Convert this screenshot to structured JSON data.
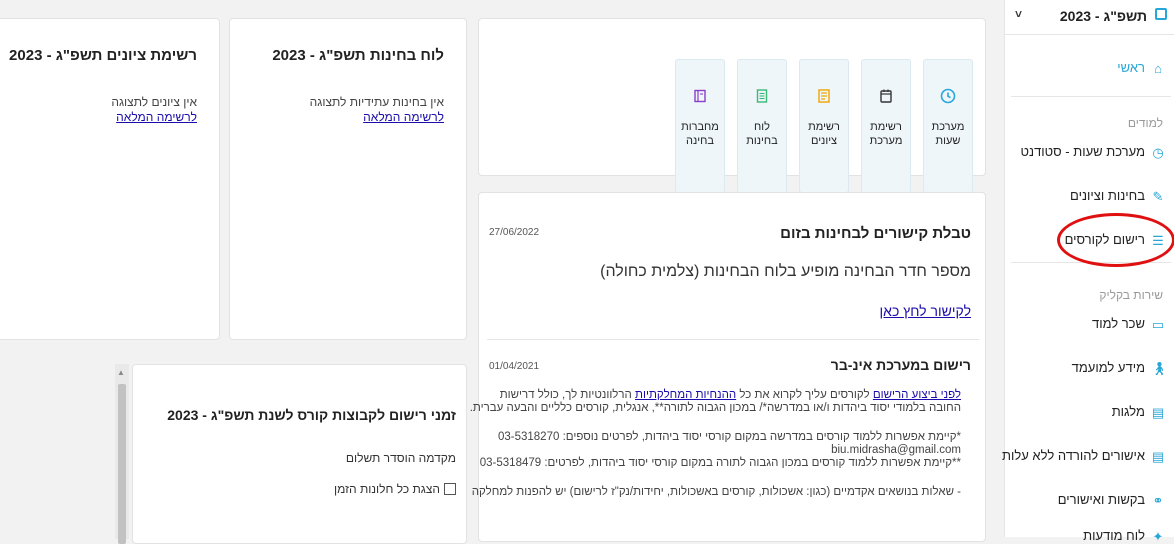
{
  "sidebar": {
    "year": "תשפ\"ג - 2023",
    "home": "ראשי",
    "section_students": "למודים",
    "timetable": "מערכת שעות - סטודנט",
    "exams_grades": "בחינות וציונים",
    "course_registration": "רישום לקורסים",
    "section_services": "שירות בקליק",
    "tuition": "שכר למוד",
    "applicant_info": "מידע למועמד",
    "scholarships": "מלגות",
    "download_confirmations": "אישורים להורדה ללא עלות",
    "requests": "בקשות ואישורים",
    "more": "לוח מודעות"
  },
  "quick_links": [
    {
      "label": "מערכת\nשעות",
      "icon": "clock-icon"
    },
    {
      "label": "רשימת\nמערכת",
      "icon": "calendar-icon"
    },
    {
      "label": "רשימת\nציונים",
      "icon": "list-icon"
    },
    {
      "label": "לוח בחינות",
      "icon": "document-icon"
    },
    {
      "label": "מחברות\nבחינה",
      "icon": "notebook-icon"
    }
  ],
  "colors": {
    "accent": "#27a6d8",
    "tile_bg": "#eef6fa",
    "highlight": "#e11010"
  },
  "exam_schedule": {
    "title": "לוח בחינות תשפ\"ג - 2023",
    "empty": "אין בחינות עתידיות לתצוגה",
    "full_list": "לרשימה המלאה"
  },
  "grades_list": {
    "title": "רשימת ציונים תשפ\"ג - 2023",
    "empty": "אין ציונים לתצוגה",
    "full_list": "לרשימה המלאה"
  },
  "registration_times": {
    "title": "זמני רישום לקבוצות קורס לשנת תשפ\"ג - 2023",
    "prerequisite": "מקדמה הוסדר תשלום",
    "show_all": "הצגת כל חלונות הזמן"
  },
  "posts": [
    {
      "title": "טבלת קישורים לבחינות בזום",
      "date": "27/06/2022",
      "body": "מספר חדר הבחינה מופיע בלוח הבחינות (צלמית כחולה)",
      "link": "לקישור לחץ כאן"
    },
    {
      "title": "רישום במערכת אינ-בר",
      "date": "01/04/2021",
      "line1_link_a": "לפני ביצוע הרישום",
      "line1_mid": " לקורסים עליך לקרוא את כל ",
      "line1_link_b": "ההנחיות המחלקתיות",
      "line1_end": " הרלוונטיות לך, כולל דרישות",
      "line2": "החובה בלמודי יסוד ביהדות ו/או במדרשה*/ במכון הגבוה לתורה**, אנגלית, קורסים כלליים והבעה עברית.",
      "line3": "*קיימת אפשרות ללמוד קורסים במדרשה במקום קורסי יסוד ביהדות, לפרטים נוספים: 03-5318270",
      "line4": "biu.midrasha@gmail.com",
      "line5": "**קיימת אפשרות ללמוד קורסים במכון הגבוה לתורה במקום קורסי יסוד ביהדות, לפרטים: 03-5318479",
      "line6": "- שאלות בנושאים אקדמיים (כגון: אשכולות, קורסים באשכולות, יחידות/נק\"ז לרישום) יש להפנות למחלקה"
    }
  ]
}
